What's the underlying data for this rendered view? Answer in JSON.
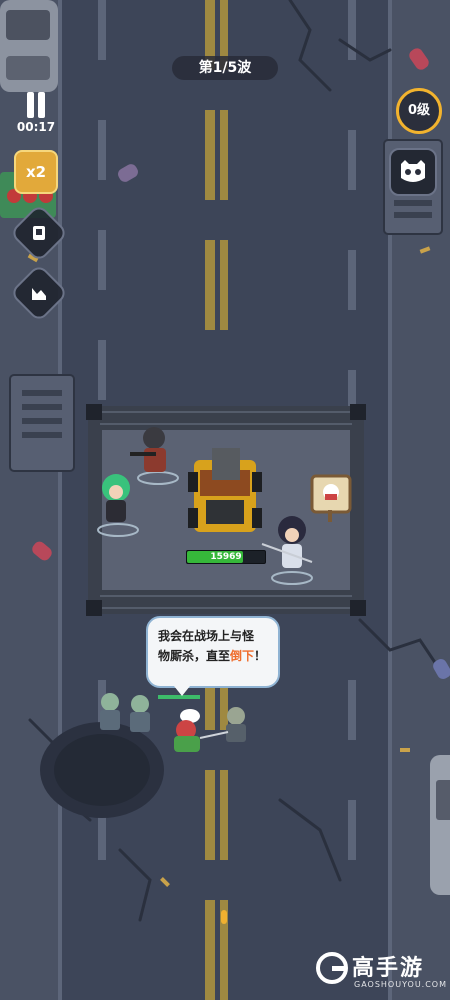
{
  "hud": {
    "wave_label": "第1/5波",
    "timer": "00:17",
    "speed_label": "x2",
    "level_label": "0级"
  },
  "base": {
    "hp_value": "15969",
    "hp_fraction": 0.72
  },
  "speech": {
    "line1": "我会在战场上与怪",
    "line2_a": "物厮杀，直至",
    "line2_highlight": "倒下",
    "line2_b": "！"
  },
  "watermark": {
    "brand": "高手游",
    "site": "GAOSHOUYOU.COM"
  },
  "colors": {
    "road": "#3b4356",
    "accent_gold": "#f2b32e",
    "hp_green": "#36b83a",
    "highlight_orange": "#ef6c2c"
  }
}
